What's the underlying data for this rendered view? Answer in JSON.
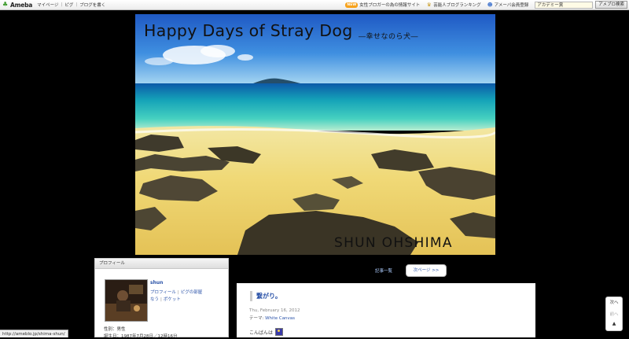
{
  "topbar": {
    "brand": "Ameba",
    "links": [
      "マイページ",
      "ピグ",
      "ブログを書く"
    ],
    "new_badge": "NEW",
    "promo": "女性ブロガーの為の情報サイト",
    "ranking": "芸能人ブログランキング",
    "register": "アメーバ会員登録",
    "search_value": "アカデミー賞",
    "search_button": "アメブロ検索"
  },
  "header": {
    "title": "Happy Days of Stray Dog",
    "subtitle": "―幸せなのら犬―",
    "author": "SHUN OHSHIMA"
  },
  "profile": {
    "header": "プロフィール",
    "name": "shun",
    "link_profile": "プロフィール",
    "link_pig_room": "ピグの部屋",
    "link_now": "なう",
    "link_pocket": "ポケット",
    "gender": "性別：男性",
    "birthday": "誕生日：1987年7月28日／12時16分"
  },
  "navigation": {
    "entry_list": "記事一覧",
    "next_page": "次ページ >>"
  },
  "article": {
    "title": "繋がり。",
    "date": "Thu, February 16, 2012",
    "theme_label": "テーマ:",
    "theme_value": "White Canvas",
    "body": "こんばんは"
  },
  "side_nav": {
    "next": "次へ",
    "prev": "前へ",
    "up": "▲"
  },
  "status_url": "http://ameblo.jp/shima-shun/",
  "colors": {
    "background": "#000000",
    "link": "#2a52a8",
    "brand_green": "#3d9b2c"
  }
}
